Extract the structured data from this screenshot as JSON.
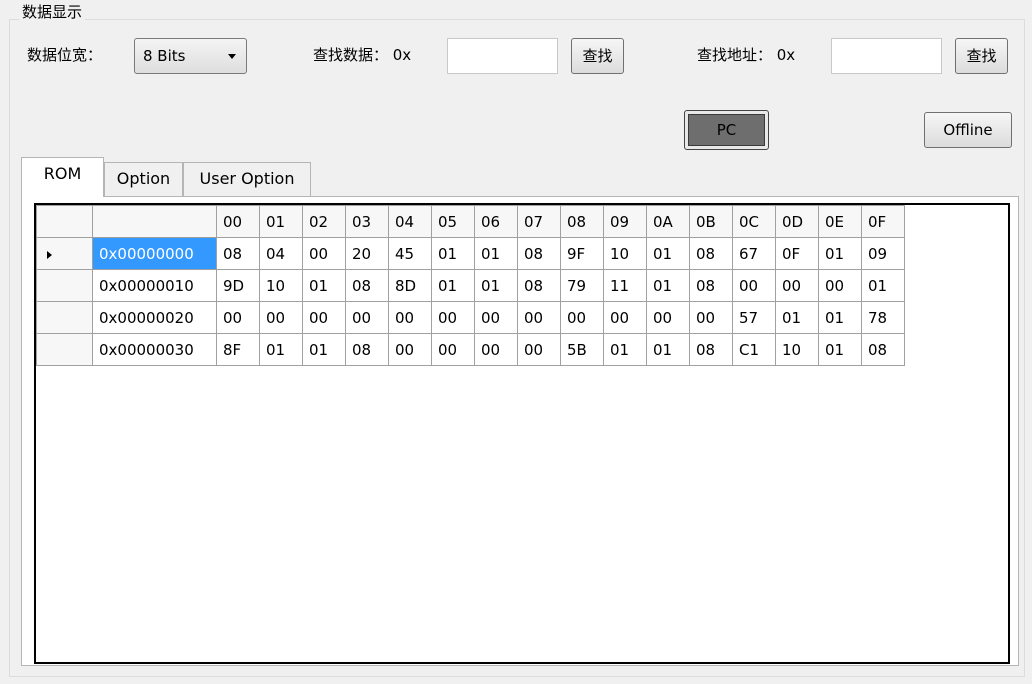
{
  "group_title": "数据显示",
  "width_label": "数据位宽：",
  "width_select": {
    "value": "8 Bits"
  },
  "find_data": {
    "label": "查找数据： 0x",
    "value": "",
    "button": "查找"
  },
  "find_addr": {
    "label": "查找地址： 0x",
    "value": "",
    "button": "查找"
  },
  "pc_button": "PC",
  "offline_button": "Offline",
  "tabs": [
    {
      "label": "ROM",
      "active": true
    },
    {
      "label": "Option",
      "active": false
    },
    {
      "label": "User Option",
      "active": false
    }
  ],
  "grid": {
    "columns": [
      "00",
      "01",
      "02",
      "03",
      "04",
      "05",
      "06",
      "07",
      "08",
      "09",
      "0A",
      "0B",
      "0C",
      "0D",
      "0E",
      "0F"
    ],
    "rows": [
      {
        "addr": "0x00000000",
        "selected": true,
        "cells": [
          "08",
          "04",
          "00",
          "20",
          "45",
          "01",
          "01",
          "08",
          "9F",
          "10",
          "01",
          "08",
          "67",
          "0F",
          "01",
          "09"
        ]
      },
      {
        "addr": "0x00000010",
        "selected": false,
        "cells": [
          "9D",
          "10",
          "01",
          "08",
          "8D",
          "01",
          "01",
          "08",
          "79",
          "11",
          "01",
          "08",
          "00",
          "00",
          "00",
          "01"
        ]
      },
      {
        "addr": "0x00000020",
        "selected": false,
        "cells": [
          "00",
          "00",
          "00",
          "00",
          "00",
          "00",
          "00",
          "00",
          "00",
          "00",
          "00",
          "00",
          "57",
          "01",
          "01",
          "78"
        ]
      },
      {
        "addr": "0x00000030",
        "selected": false,
        "cells": [
          "8F",
          "01",
          "01",
          "08",
          "00",
          "00",
          "00",
          "00",
          "5B",
          "01",
          "01",
          "08",
          "C1",
          "10",
          "01",
          "08"
        ]
      }
    ]
  },
  "colors": {
    "selection": "#3399ff",
    "pc_fill": "#6e6e6e"
  }
}
